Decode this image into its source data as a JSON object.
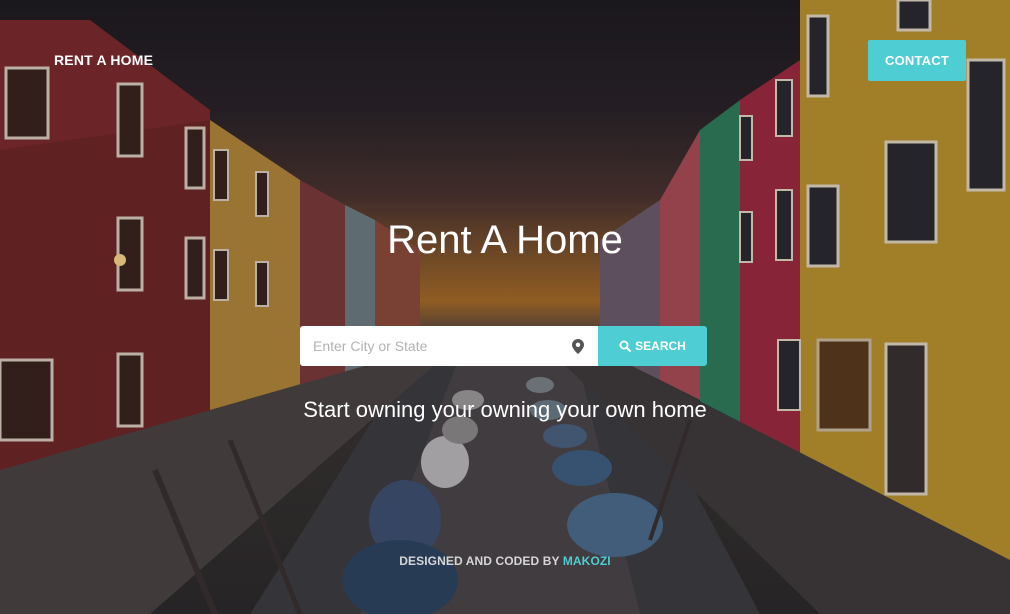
{
  "nav": {
    "brand": "RENT A HOME",
    "contact_label": "CONTACT"
  },
  "hero": {
    "title": "Rent A Home",
    "tagline": "Start owning your owning your own home"
  },
  "search": {
    "placeholder": "Enter City or State",
    "value": "",
    "button_label": "SEARCH"
  },
  "footer": {
    "credit_prefix": "DESIGNED AND CODED BY ",
    "author": "MAKOZI"
  },
  "colors": {
    "accent": "#4ecdd2"
  },
  "icons": {
    "search_field_icon": "map-pin-icon",
    "search_button_icon": "search-icon"
  }
}
